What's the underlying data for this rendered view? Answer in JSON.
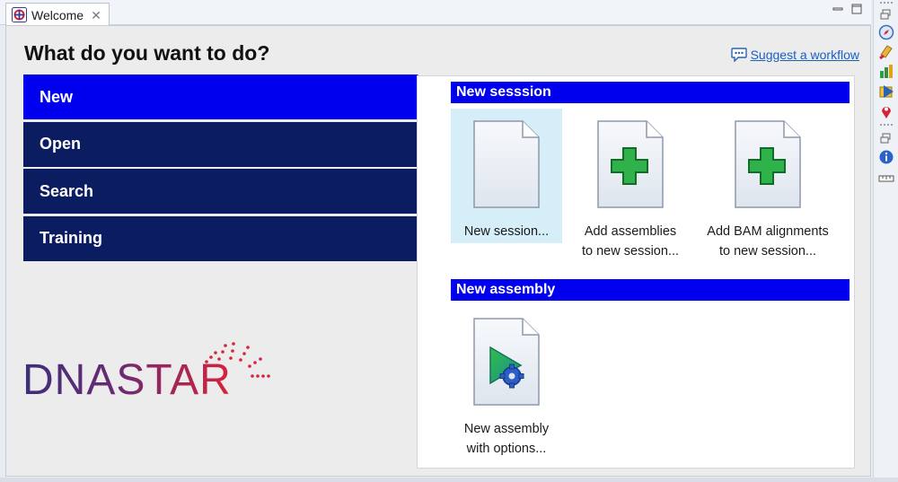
{
  "tab": {
    "label": "Welcome"
  },
  "page": {
    "heading": "What do you want to do?",
    "suggest_link": "Suggest a workflow"
  },
  "nav": {
    "items": [
      {
        "label": "New",
        "active": true
      },
      {
        "label": "Open",
        "active": false
      },
      {
        "label": "Search",
        "active": false
      },
      {
        "label": "Training",
        "active": false
      }
    ]
  },
  "logo": {
    "text": "DNASTAR"
  },
  "sections": {
    "new_session": {
      "title": "New sesssion",
      "tiles": [
        {
          "line1": "New session...",
          "line2": ""
        },
        {
          "line1": "Add assemblies",
          "line2": "to new session..."
        },
        {
          "line1": "Add BAM alignments",
          "line2": "to new session..."
        }
      ]
    },
    "new_assembly": {
      "title": "New assembly",
      "tiles": [
        {
          "line1": "New assembly",
          "line2": "with options..."
        }
      ]
    }
  },
  "colors": {
    "nav_bg": "#0b1c61",
    "nav_active": "#0000ee",
    "link": "#1a5fc4",
    "selected_tile": "#d5eef8",
    "logo_start": "#3b2f7a",
    "logo_end": "#d8223a"
  },
  "icons": {
    "tab": "welcome-icon",
    "suggest": "speech-bubble-icon",
    "tiles": [
      "blank-document-icon",
      "document-plus-icon",
      "document-plus-icon",
      "document-play-gear-icon"
    ],
    "toolbar": [
      "restore-icon",
      "compass-icon",
      "paint-icon",
      "chart-icon",
      "folder-tag-icon",
      "map-pin-icon",
      "restore-icon",
      "info-icon",
      "ruler-icon"
    ]
  }
}
